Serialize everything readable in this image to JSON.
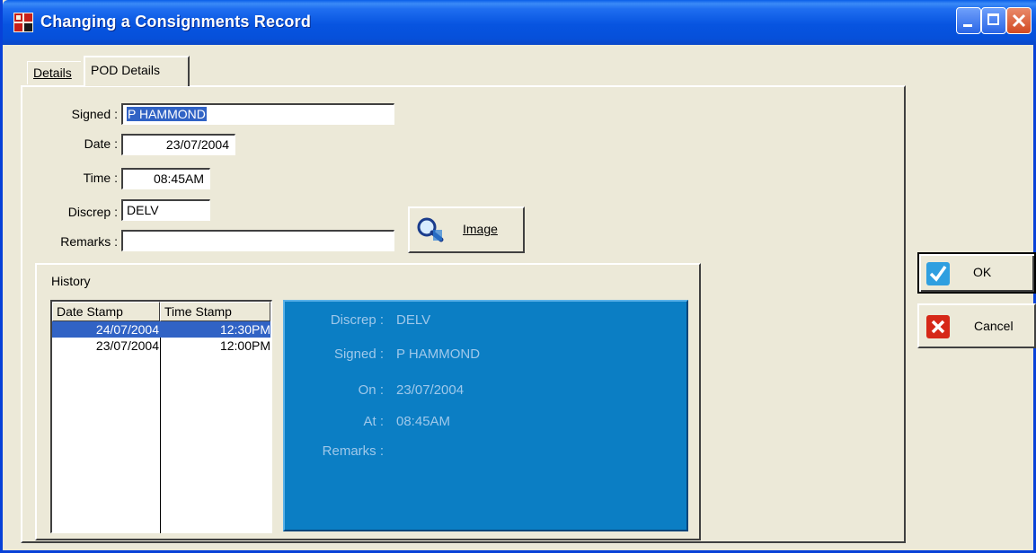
{
  "window": {
    "title": "Changing a Consignments Record"
  },
  "tabs": [
    {
      "label": "Details"
    },
    {
      "label": "POD Details"
    }
  ],
  "form": {
    "signed_label": "Signed :",
    "signed_value": "P HAMMOND",
    "date_label": "Date :",
    "date_value": "23/07/2004",
    "time_label": "Time :",
    "time_value": "08:45AM",
    "discrep_label": "Discrep :",
    "discrep_value": "DELV",
    "remarks_label": "Remarks :",
    "remarks_value": ""
  },
  "buttons": {
    "image": "Image",
    "ok": "OK",
    "cancel": "Cancel"
  },
  "history": {
    "title": "History",
    "columns": [
      "Date Stamp",
      "Time Stamp"
    ],
    "rows": [
      {
        "date": "24/07/2004",
        "time": "12:30PM",
        "selected": true
      },
      {
        "date": "23/07/2004",
        "time": "12:00PM",
        "selected": false
      }
    ],
    "detail": {
      "discrep_label": "Discrep :",
      "discrep_value": "DELV",
      "signed_label": "Signed :",
      "signed_value": "P HAMMOND",
      "on_label": "On :",
      "on_value": "23/07/2004",
      "at_label": "At :",
      "at_value": "08:45AM",
      "remarks_label": "Remarks :",
      "remarks_value": ""
    }
  },
  "colors": {
    "titlebar": "#0754e0",
    "selection": "#3163c5",
    "detail_panel": "#0b7ec4",
    "ok_icon": "#2f9fe0",
    "cancel_icon": "#d62818"
  },
  "icons": {
    "app": "app-icon",
    "image_button": "magnifier-icon",
    "ok": "checkmark-icon",
    "cancel": "x-icon"
  }
}
